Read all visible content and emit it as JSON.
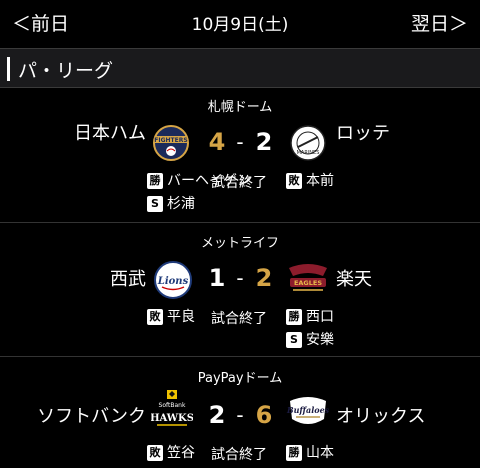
{
  "nav": {
    "prev_label": "＜前日",
    "date": "10月9日(土)",
    "next_label": "翌日＞"
  },
  "league": {
    "name": "パ・リーグ"
  },
  "games": [
    {
      "venue": "札幌ドーム",
      "home": {
        "name": "日本ハム",
        "logo": "fighters-logo",
        "score": "4"
      },
      "away": {
        "name": "ロッテ",
        "logo": "marines-logo",
        "score": "2"
      },
      "dash": "-",
      "status": "試合終了",
      "left_pitchers": [
        {
          "badge": "勝",
          "name": "バーヘイゲン"
        },
        {
          "badge": "S",
          "name": "杉浦"
        }
      ],
      "right_pitchers": [
        {
          "badge": "敗",
          "name": "本前"
        }
      ]
    },
    {
      "venue": "メットライフ",
      "home": {
        "name": "西武",
        "logo": "lions-logo",
        "score": "1"
      },
      "away": {
        "name": "楽天",
        "logo": "eagles-logo",
        "score": "2"
      },
      "dash": "-",
      "status": "試合終了",
      "left_pitchers": [
        {
          "badge": "敗",
          "name": "平良"
        }
      ],
      "right_pitchers": [
        {
          "badge": "勝",
          "name": "西口"
        },
        {
          "badge": "S",
          "name": "安樂"
        }
      ]
    },
    {
      "venue": "PayPayドーム",
      "home": {
        "name": "ソフトバンク",
        "logo": "hawks-logo",
        "score": "2"
      },
      "away": {
        "name": "オリックス",
        "logo": "buffaloes-logo",
        "score": "6"
      },
      "dash": "-",
      "status": "試合終了",
      "left_pitchers": [
        {
          "badge": "敗",
          "name": "笠谷"
        }
      ],
      "right_pitchers": [
        {
          "badge": "勝",
          "name": "山本"
        }
      ]
    }
  ],
  "colors": {
    "win_score": "#d6a546",
    "background": "#000000",
    "header_bg": "#1a1a1c"
  }
}
